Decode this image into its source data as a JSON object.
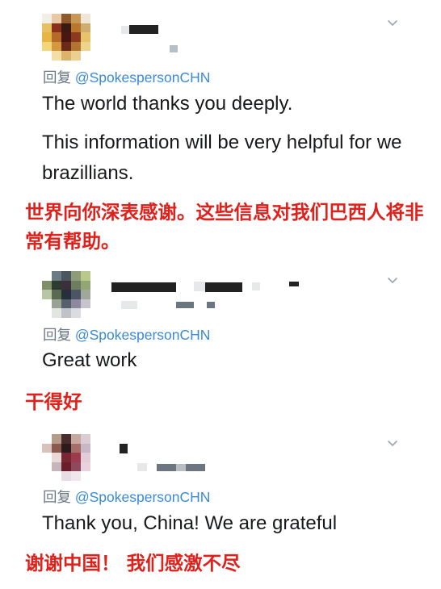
{
  "replies": [
    {
      "reply_label": "回复",
      "handle": "@SpokespersonCHN",
      "paragraphs": [
        "The world thanks you deeply.",
        "This information will be very helpful for we brazillians."
      ],
      "translation": "世界向你深表感谢。这些信息对我们巴西人将非常有帮助。",
      "menu_icon": "chevron-down-icon"
    },
    {
      "reply_label": "回复",
      "handle": "@SpokespersonCHN",
      "paragraphs": [
        "Great work"
      ],
      "translation": "干得好",
      "menu_icon": "chevron-down-icon"
    },
    {
      "reply_label": "回复",
      "handle": "@SpokespersonCHN",
      "paragraphs": [
        "Thank you, China! We are grateful"
      ],
      "translation": "谢谢中国！ 我们感激不尽",
      "menu_icon": "chevron-down-icon"
    }
  ],
  "colors": {
    "handle": "#3a8ad8",
    "meta": "#6a7683",
    "translation": "#e0201a",
    "chevron": "#9aa5b0"
  }
}
